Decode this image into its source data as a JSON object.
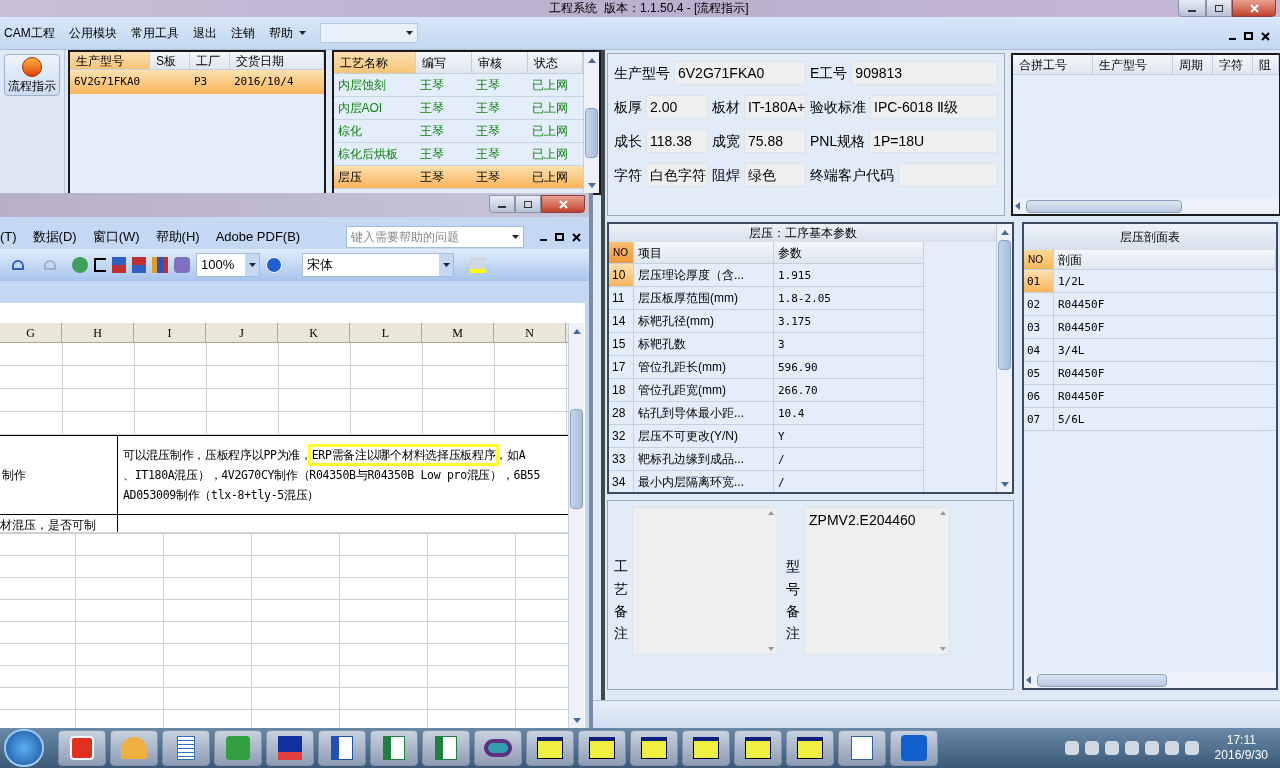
{
  "title": "工程系统  版本：1.1.50.4 - [流程指示]",
  "menu": [
    "CAM工程",
    "公用模块",
    "常用工具",
    "退出",
    "注销",
    "帮助"
  ],
  "flow_button": "流程指示",
  "products": {
    "columns": [
      "生产型号",
      "S板",
      "工厂",
      "交货日期"
    ],
    "rows": [
      {
        "model": "6V2G71FKA0",
        "factory": "P3",
        "date": "2016/10/4",
        "selected": true
      }
    ]
  },
  "processes": {
    "columns": [
      "工艺名称",
      "编写",
      "审核",
      "状态"
    ],
    "rows": [
      {
        "cells": [
          "内层蚀刻",
          "王琴",
          "王琴",
          "已上网"
        ],
        "selected": false
      },
      {
        "cells": [
          "内层AOI",
          "王琴",
          "王琴",
          "已上网"
        ],
        "selected": false
      },
      {
        "cells": [
          "棕化",
          "王琴",
          "王琴",
          "已上网"
        ],
        "selected": false
      },
      {
        "cells": [
          "棕化后烘板",
          "王琴",
          "王琴",
          "已上网"
        ],
        "selected": false
      },
      {
        "cells": [
          "层压",
          "王琴",
          "王琴",
          "已上网"
        ],
        "selected": true
      }
    ]
  },
  "info": [
    [
      {
        "label": "生产型号",
        "value": "6V2G71FKA0"
      },
      {
        "label": "E工号",
        "value": "909813"
      }
    ],
    [
      {
        "label": "板厚",
        "value": "2.00"
      },
      {
        "label": "板材",
        "value": "IT-180A+"
      },
      {
        "label": "验收标准",
        "value": "IPC-6018 Ⅱ级"
      }
    ],
    [
      {
        "label": "成长",
        "value": "118.38"
      },
      {
        "label": "成宽",
        "value": "75.88"
      },
      {
        "label": "PNL规格",
        "value": "1P=18U"
      }
    ],
    [
      {
        "label": "字符",
        "value": "白色字符"
      },
      {
        "label": "阻焊",
        "value": "绿色"
      },
      {
        "label": "终端客户代码"
      }
    ]
  ],
  "merge_table": {
    "columns": [
      "合拼工号",
      "生产型号",
      "周期",
      "字符",
      "阻"
    ]
  },
  "params": {
    "title": "层压：工序基本参数",
    "columns": [
      "NO",
      "项目",
      "参数"
    ],
    "rows": [
      {
        "no": "10",
        "item": "层压理论厚度（含...",
        "value": "1.915",
        "selected": true
      },
      {
        "no": "11",
        "item": "层压板厚范围(mm)",
        "value": "1.8-2.05",
        "selected": false
      },
      {
        "no": "14",
        "item": "标靶孔径(mm)",
        "value": "3.175",
        "selected": false
      },
      {
        "no": "15",
        "item": "标靶孔数",
        "value": "3",
        "selected": false
      },
      {
        "no": "17",
        "item": "管位孔距长(mm)",
        "value": "596.90",
        "selected": false
      },
      {
        "no": "18",
        "item": "管位孔距宽(mm)",
        "value": "266.70",
        "selected": false
      },
      {
        "no": "28",
        "item": "钻孔到导体最小距...",
        "value": "10.4",
        "selected": false
      },
      {
        "no": "32",
        "item": "层压不可更改(Y/N)",
        "value": "Y",
        "selected": false
      },
      {
        "no": "33",
        "item": "靶标孔边缘到成品...",
        "value": "/",
        "selected": false
      },
      {
        "no": "34",
        "item": "最小内层隔离环宽...",
        "value": "/",
        "selected": false
      }
    ]
  },
  "section": {
    "title": "层压剖面表",
    "columns": [
      "NO",
      "剖面"
    ],
    "rows": [
      {
        "no": "01",
        "value": "1/2L",
        "selected": true
      },
      {
        "no": "02",
        "value": "R04450F",
        "selected": false
      },
      {
        "no": "03",
        "value": "R04450F",
        "selected": false
      },
      {
        "no": "04",
        "value": "3/4L",
        "selected": false
      },
      {
        "no": "05",
        "value": "R04450F",
        "selected": false
      },
      {
        "no": "06",
        "value": "R04450F",
        "selected": false
      },
      {
        "no": "07",
        "value": "5/6L",
        "selected": false
      }
    ]
  },
  "remarks": [
    {
      "label": "工艺备注"
    },
    {
      "label": "型号备注",
      "value": "ZPMV2.E204460"
    }
  ],
  "excel": {
    "menu": [
      "(T)",
      "数据(D)",
      "窗口(W)",
      "帮助(H)",
      "Adobe PDF(B)"
    ],
    "help_placeholder": "键入需要帮助的问题",
    "zoom": "100%",
    "font": "宋体",
    "columns": [
      "G",
      "H",
      "I",
      "J",
      "K",
      "L",
      "M",
      "N"
    ],
    "row_a_left": "制作",
    "row_a_first": {
      "before": "可以混压制作，压板程序以PP为准，",
      "highlighted": "ERP需备注以哪个材料选择压板程序",
      "after": "，如A"
    },
    "row_a_lines": [
      "、IT180A混压），4V2G70CY制作（R04350B与R04350B Low pro混压），6B55",
      "AD053009制作（tlx-8+tly-5混压）"
    ],
    "row_b_left": "材混压，是否可制"
  },
  "taskbar": {
    "time": "17:11",
    "date": "2016/9/30"
  }
}
